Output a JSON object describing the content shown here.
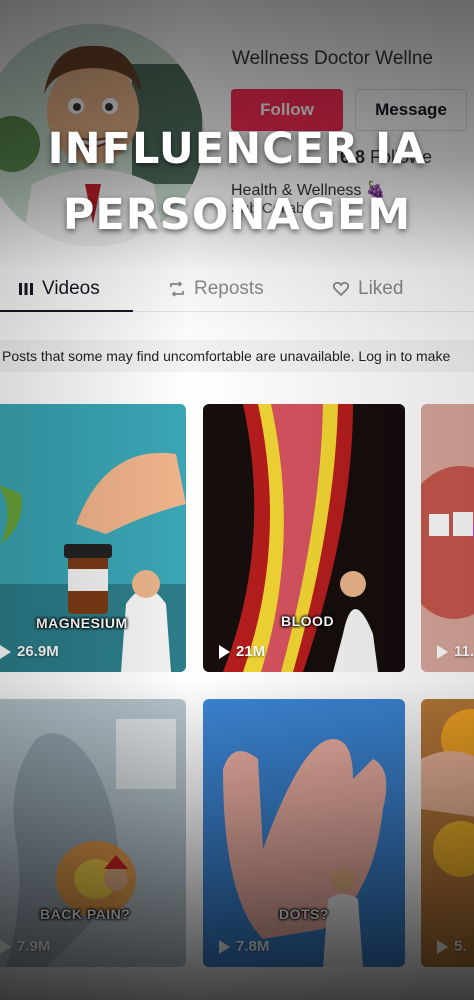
{
  "profile": {
    "name": "Wellness Doctor Wellne",
    "follow_label": "Follow",
    "message_label": "Message",
    "stats_count": "6.8",
    "stats_label": "Followe",
    "bio_line1": "Health & Wellness 🍇",
    "bio_line2": "Sub Collabo"
  },
  "tabs": [
    {
      "label": "Videos",
      "icon": "grid-icon",
      "active": true
    },
    {
      "label": "Reposts",
      "icon": "repost-icon",
      "active": false
    },
    {
      "label": "Liked",
      "icon": "heart-icon",
      "active": false
    }
  ],
  "notice": "Posts that some may find uncomfortable are unavailable. Log in to make",
  "videos": [
    {
      "caption": "MAGNESIUM",
      "views": "26.9M"
    },
    {
      "caption": "BLOOD",
      "views": "21M"
    },
    {
      "caption": "",
      "views": "11."
    },
    {
      "caption": "BACK PAIN?",
      "views": "7.9M"
    },
    {
      "caption": "DOTS?",
      "views": "7.8M"
    },
    {
      "caption": "",
      "views": "5."
    }
  ],
  "overlay": {
    "line1": "INFLUENCER IA",
    "line2": "PERSONAGEM"
  },
  "colors": {
    "follow": "#fe2c55",
    "text": "#161823",
    "muted": "#8a8b91"
  }
}
